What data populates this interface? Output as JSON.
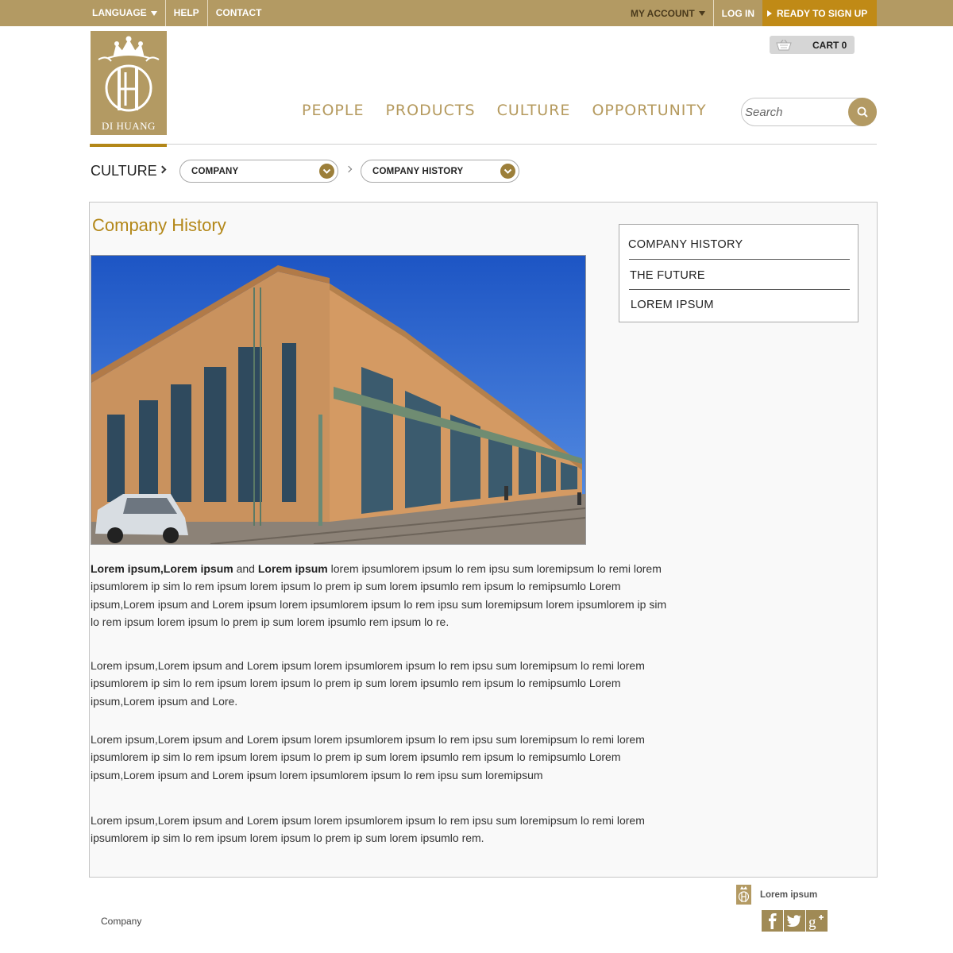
{
  "topbar": {
    "language": "LANGUAGE",
    "help": "HELP",
    "contact": "CONTACT",
    "my_account": "MY ACCOUNT",
    "login": "LOG IN",
    "signup": "READY TO SIGN UP"
  },
  "brand": {
    "name": "DI HUANG"
  },
  "cart": {
    "label": "CART 0"
  },
  "nav": [
    "PEOPLE",
    "PRODUCTS",
    "CULTURE",
    "OPPORTUNITY"
  ],
  "search": {
    "placeholder": "Search"
  },
  "breadcrumb": {
    "section": "CULTURE",
    "select1": "COMPANY",
    "select2": "COMPANY HISTORY"
  },
  "main": {
    "title": "Company History",
    "photo": "brick warehouse building with parked car under blue sky",
    "paragraphs": [
      {
        "bold1": "Lorem ipsum,Lorem ipsum",
        "and": " and ",
        "bold2": "Lorem ipsum",
        "rest": " lorem ipsumlorem ipsum lo rem ipsu sum loremipsum lo remi lorem ipsumlorem ip sim lo rem ipsum lorem ipsum lo prem ip sum lorem ipsumlo rem ipsum lo remipsumlo Lorem ipsum,Lorem ipsum and Lorem ipsum lorem ipsumlorem ipsum lo rem ipsu sum loremipsum lorem ipsumlorem ip sim lo rem ipsum lorem ipsum lo prem ip sum lorem ipsumlo rem ipsum lo re."
      },
      {
        "text": "Lorem ipsum,Lorem ipsum and Lorem ipsum lorem ipsumlorem ipsum lo rem ipsu sum loremipsum lo remi lorem ipsumlorem ip sim lo rem ipsum lorem ipsum lo prem ip sum lorem ipsumlo rem ipsum lo remipsumlo Lorem ipsum,Lorem ipsum and Lore."
      },
      {
        "text": "Lorem ipsum,Lorem ipsum and Lorem ipsum lorem ipsumlorem ipsum lo rem ipsu sum loremipsum lo remi lorem ipsumlorem ip sim lo rem ipsum lorem ipsum lo prem ip sum lorem ipsumlo rem ipsum lo remipsumlo Lorem ipsum,Lorem ipsum and Lorem ipsum lorem ipsumlorem ipsum lo rem ipsu sum loremipsum"
      },
      {
        "text": "Lorem ipsum,Lorem ipsum and Lorem ipsum lorem ipsumlorem ipsum lo rem ipsu sum loremipsum lo remi lorem ipsumlorem ip sim lo rem ipsum lorem ipsum lo prem ip sum lorem ipsumlo rem."
      }
    ]
  },
  "subnav": [
    "COMPANY HISTORY",
    "THE FUTURE",
    "LOREM IPSUM"
  ],
  "footer": {
    "company": "Company",
    "lorem": "Lorem ipsum",
    "social": [
      "facebook-icon",
      "twitter-icon",
      "google-plus-icon"
    ]
  },
  "colors": {
    "topbar": "#b39a63",
    "signup": "#c08a16",
    "accent": "#b38718",
    "nav": "#b59a5e"
  }
}
